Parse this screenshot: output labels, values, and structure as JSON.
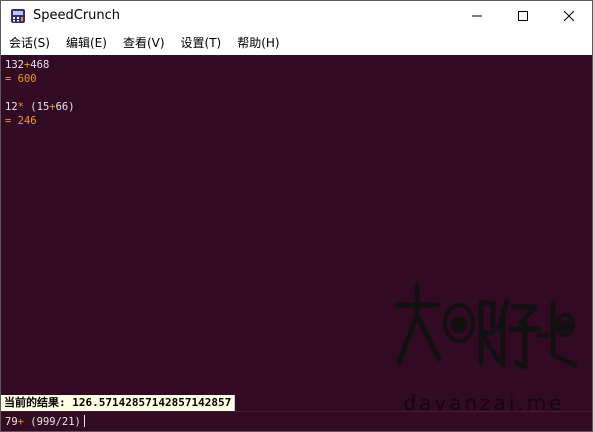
{
  "window": {
    "title": "SpeedCrunch",
    "icon": "speedcrunch-app-icon"
  },
  "menu": [
    {
      "label": "会话(S)"
    },
    {
      "label": "编辑(E)"
    },
    {
      "label": "查看(V)"
    },
    {
      "label": "设置(T)"
    },
    {
      "label": "帮助(H)"
    }
  ],
  "history": [
    {
      "expr_a": "132",
      "op": "+",
      "expr_b": "468",
      "result": "= 600"
    },
    {
      "expr_a": "12",
      "op": "*",
      "expr_b": " (15",
      "op2": "+",
      "expr_c": "66)",
      "result": "= 246"
    }
  ],
  "status": {
    "label": "当前的结果: ",
    "value": "126.57142857142857142857"
  },
  "input": {
    "a": "79",
    "op": "+",
    "b": " (999/21)"
  },
  "watermark": {
    "text": "dayanzai.me",
    "logo_chars": "大眼仔-旭"
  },
  "colors": {
    "display_bg": "#330a24",
    "expression": "#e8e4e6",
    "result": "#6f9ecb",
    "operator": "#e89a1e"
  }
}
